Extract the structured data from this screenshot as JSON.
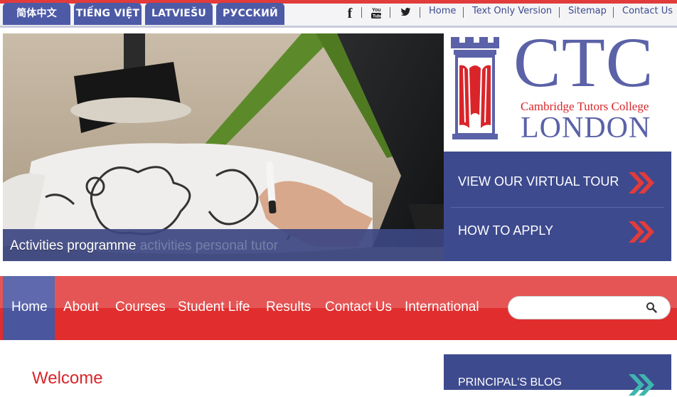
{
  "languages": [
    {
      "label": "简体中文"
    },
    {
      "label": "TIẾNG VIỆT"
    },
    {
      "label": "LATVIEŠU"
    },
    {
      "label": "РУССКИЙ"
    }
  ],
  "social": [
    {
      "icon": "facebook-icon",
      "glyph": "f"
    },
    {
      "icon": "youtube-icon",
      "glyph": "You"
    },
    {
      "icon": "twitter-icon",
      "glyph": "t"
    }
  ],
  "top_links": {
    "home": "Home",
    "text_only": "Text Only Version",
    "sitemap": "Sitemap",
    "contact": "Contact Us"
  },
  "hero": {
    "caption": "Activities programme",
    "caption_ghost": "Activities programme activities personal tutor"
  },
  "logo": {
    "letters": "CTC",
    "subtitle": "Cambridge Tutors College",
    "city": "LONDON"
  },
  "cta": {
    "tour": "VIEW OUR VIRTUAL TOUR",
    "apply": "HOW TO APPLY"
  },
  "nav": {
    "items": [
      "Home",
      "About",
      "Courses",
      "Student Life",
      "Results",
      "Contact Us",
      "International"
    ],
    "active": "Home"
  },
  "search": {
    "placeholder": ""
  },
  "content": {
    "welcome": "Welcome",
    "blog": "PRINCIPAL'S BLOG"
  },
  "colors": {
    "brand_blue": "#4d5aa6",
    "brand_red": "#e12d2d",
    "panel_blue": "#3e4a8e"
  }
}
